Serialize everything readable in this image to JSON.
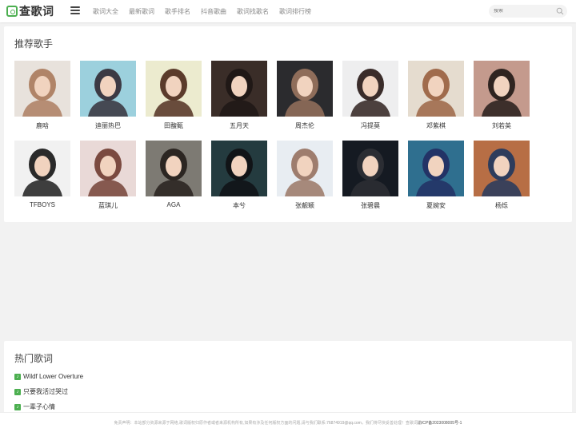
{
  "header": {
    "logo_text": "查歌词",
    "nav": [
      "歌词大全",
      "最新歌词",
      "歌手排名",
      "抖音歌曲",
      "歌词找歌名",
      "歌词排行榜"
    ],
    "search_placeholder": "搜索"
  },
  "singers": {
    "title": "推荐歌手",
    "items": [
      {
        "name": "鹿晗",
        "bg": "#e8e2dc",
        "tone": "#b08468"
      },
      {
        "name": "迪丽热巴",
        "bg": "#9cd0dd",
        "tone": "#3c3a44"
      },
      {
        "name": "田馥甄",
        "bg": "#ecebcf",
        "tone": "#5b3b2b"
      },
      {
        "name": "五月天",
        "bg": "#3a2d28",
        "tone": "#201816"
      },
      {
        "name": "周杰伦",
        "bg": "#2b2b2e",
        "tone": "#8f6d5a"
      },
      {
        "name": "冯提莫",
        "bg": "#eeeeef",
        "tone": "#3a2c2a"
      },
      {
        "name": "邓紫棋",
        "bg": "#e5dccf",
        "tone": "#a06b4c"
      },
      {
        "name": "刘若英",
        "bg": "#c49a8d",
        "tone": "#2f2420"
      },
      {
        "name": "TFBOYS",
        "bg": "#f1f1f1",
        "tone": "#2a2a2a"
      },
      {
        "name": "蓝琪儿",
        "bg": "#e9d9d7",
        "tone": "#7b4a40"
      },
      {
        "name": "AGA",
        "bg": "#7d7a73",
        "tone": "#2c2622"
      },
      {
        "name": "本兮",
        "bg": "#243b3f",
        "tone": "#111417"
      },
      {
        "name": "张靓颖",
        "bg": "#e8edf2",
        "tone": "#9e7d6e"
      },
      {
        "name": "张碧晨",
        "bg": "#151a22",
        "tone": "#2b2d33"
      },
      {
        "name": "夏婉安",
        "bg": "#2f6f8f",
        "tone": "#233366"
      },
      {
        "name": "杨烁",
        "bg": "#b76e45",
        "tone": "#2d3c5c"
      }
    ]
  },
  "hot_lyrics": {
    "title": "热门歌词",
    "items": [
      "Wildf Lower Overture",
      "只要我活过哭过",
      "一辈子心情"
    ]
  },
  "footer": {
    "disclaimer": "免责声明：本站部分资源来源于网络,歌词版权归原作者或者来源机构所有,如果有涉及任何版权方面的问题,请与我们联系:",
    "email": "76874919@qq.com",
    "tail": "，我们将尽快妥善处理！查歌词",
    "icp": "渝ICP备2023008005号-1"
  },
  "colors": {
    "brand": "#4caf50",
    "text": "#333333",
    "background": "#f2f2f2"
  }
}
